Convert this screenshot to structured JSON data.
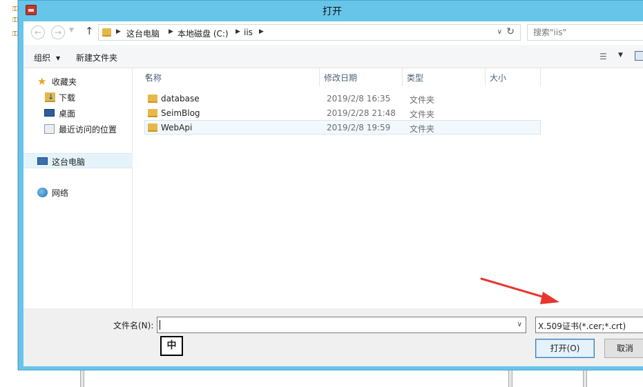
{
  "window": {
    "title": "打开"
  },
  "nav": {
    "back_glyph": "←",
    "forward_glyph": "→",
    "dropdown_glyph": "▼",
    "up_glyph": "↑"
  },
  "address": {
    "sep_glyph": "▶",
    "crumbs": [
      "这台电脑",
      "本地磁盘 (C:)",
      "iis"
    ],
    "dropdown_glyph": "∨",
    "refresh_glyph": "↻"
  },
  "search": {
    "placeholder": "搜索\"iis\""
  },
  "toolbar": {
    "organize_label": "组织",
    "organize_caret": "▼",
    "new_folder_label": "新建文件夹",
    "view_dropdown_glyph": "▼",
    "view_icon_glyph": "☰"
  },
  "navpane": {
    "favorites": "收藏夹",
    "star_glyph": "★",
    "downloads": "下载",
    "desktop": "桌面",
    "recent": "最近访问的位置",
    "this_pc": "这台电脑",
    "network": "网络"
  },
  "columns": {
    "name": "名称",
    "date": "修改日期",
    "type": "类型",
    "size": "大小",
    "sort_glyph": "▲"
  },
  "files": [
    {
      "name": "database",
      "date": "2019/2/8 16:35",
      "type": "文件夹"
    },
    {
      "name": "SeimBlog",
      "date": "2019/2/28 21:48",
      "type": "文件夹"
    },
    {
      "name": "WebApi",
      "date": "2019/2/8 19:59",
      "type": "文件夹"
    }
  ],
  "footer": {
    "filename_label": "文件名(N):",
    "filename_value": "",
    "ime_indicator": "中",
    "filter_value": "X.509证书(*.cer;*.crt)",
    "combo_dropdown_glyph": "∨",
    "open_label": "打开(O)",
    "cancel_label": "取消"
  },
  "colors": {
    "titlebar": "#68c5ea",
    "selection": "#e5f3fb",
    "arrow": "#e8352f",
    "folder": "#e6b84a"
  }
}
